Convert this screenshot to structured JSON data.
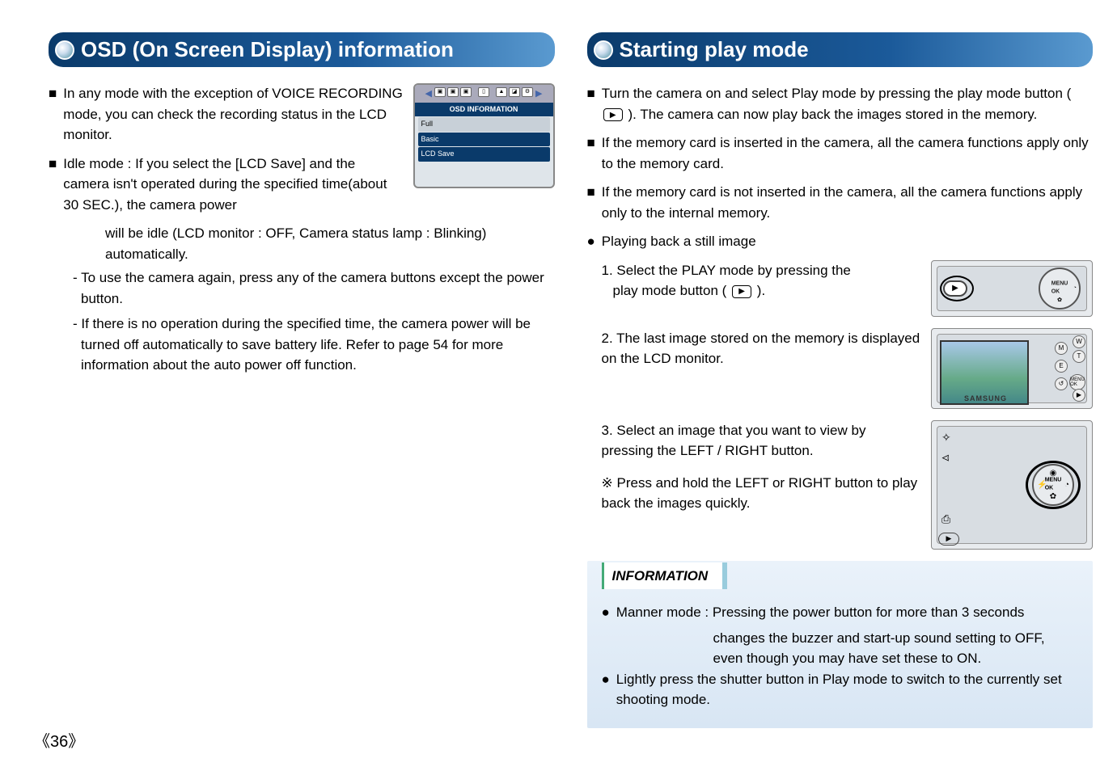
{
  "left": {
    "title": "OSD (On Screen Display) information",
    "p1": "In any mode with the exception of VOICE RECORDING mode, you can check the recording status in the LCD monitor.",
    "p2_lead": "Idle mode : If you select the [LCD Save] and the camera isn't operated during the specified time(about 30 SEC.), the camera power",
    "p2_cont": "will be idle (LCD monitor : OFF, Camera status lamp : Blinking) automatically.",
    "d1": "- To use the camera again, press any of the camera buttons except the power button.",
    "d2": "- If there is no operation during the specified time, the camera power will be turned off automatically to save battery life. Refer to page 54 for more information about the auto power off function.",
    "osd": {
      "header": "OSD INFORMATION",
      "items": [
        "Full",
        "Basic",
        "LCD Save"
      ]
    }
  },
  "right": {
    "title": "Starting play mode",
    "b1a": "Turn the camera on and select Play mode by pressing the play mode button",
    "b1b": "). The camera can now play back the images stored in the memory.",
    "b2": "If the memory card is inserted in the camera, all the camera functions apply only to the memory card.",
    "b3": "If the memory card is not inserted in the camera, all the camera functions apply only to the internal memory.",
    "play_head": "Playing back a still image",
    "s1a": "1. Select the PLAY mode by pressing the",
    "s1b": "play mode button (",
    "s1c": ").",
    "s2": "2. The last image stored on the memory is displayed on the LCD monitor.",
    "s3": "3. Select an image that you want to view by pressing the LEFT / RIGHT button.",
    "note": "Press and hold the LEFT or RIGHT button to play back the images quickly.",
    "info_title": "INFORMATION",
    "info1": "Manner mode : Pressing the power button for more than 3 seconds",
    "info1b": "changes the buzzer and start-up sound setting to OFF, even though you may have set these to ON.",
    "info2": "Lightly press the shutter button in Play mode to switch to the currently set shooting mode."
  },
  "page_number": "《36》",
  "icons": {
    "sq_bullet": "■",
    "dot_bullet": "●",
    "note_mark": "※",
    "play": "▶",
    "menu_ok": "MENU\nOK",
    "flower": "✿",
    "flash": "⚡",
    "timer": "◔",
    "brand": "SAMSUNG"
  }
}
